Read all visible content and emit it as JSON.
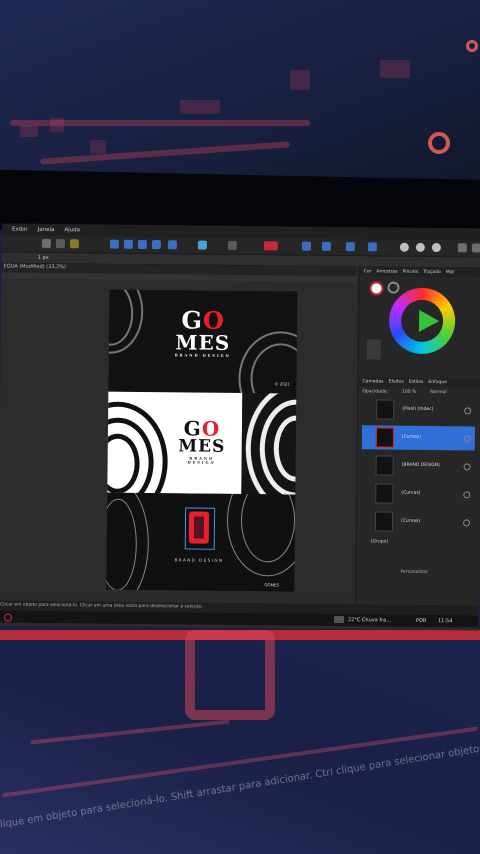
{
  "app": {
    "menu": [
      "Exibir",
      "Janela",
      "Ajuda"
    ],
    "document_tab": "EGUA (Modified) (33,2%)",
    "context_zoom": "1 px"
  },
  "artwork": {
    "logo_line1_a": "G",
    "logo_line1_b": "O",
    "logo_line2": "MES",
    "logo_sub": "BRAND DESIGN",
    "mid_line1_a": "G",
    "mid_line1_b": "O",
    "mid_line2": "MES",
    "mid_sub": "BRAND DESIGN",
    "bottom_sub": "BRAND DESIGN",
    "badge_top": "© 2021",
    "badge_bottom": "GOMES"
  },
  "right_panel": {
    "tabs": [
      "Cor",
      "Amostras",
      "Pincéis",
      "Traçado",
      "Mat"
    ],
    "layers_tabs": [
      "Camadas",
      "Efeitos",
      "Estilos",
      "Enfoque"
    ],
    "opacity_label": "Opacidade:",
    "opacity_value": "100 %",
    "blend_mode": "Normal",
    "layers": [
      {
        "name": "(Pixel) (Indec)",
        "active": false
      },
      {
        "name": "(Curvas)",
        "active": true
      },
      {
        "name": "(BRAND DESIGN)",
        "active": false
      },
      {
        "name": "(Curvas)",
        "active": false
      },
      {
        "name": "(Curvas)",
        "active": false
      }
    ],
    "group_label": "(Grupo)",
    "footer_label": "Personalizar"
  },
  "status_bar": {
    "hint": "Clicar em objeto para selecioná-lo. Clicar em uma área vazia para deselecionar a seleção."
  },
  "taskbar": {
    "weather": "22°C Chuva fra...",
    "lang": "POR",
    "time": "11:54"
  },
  "background_hint": "Clique em objeto para selecioná-lo. Shift arrastar para adicionar. Ctrl clique para selecionar objetos"
}
